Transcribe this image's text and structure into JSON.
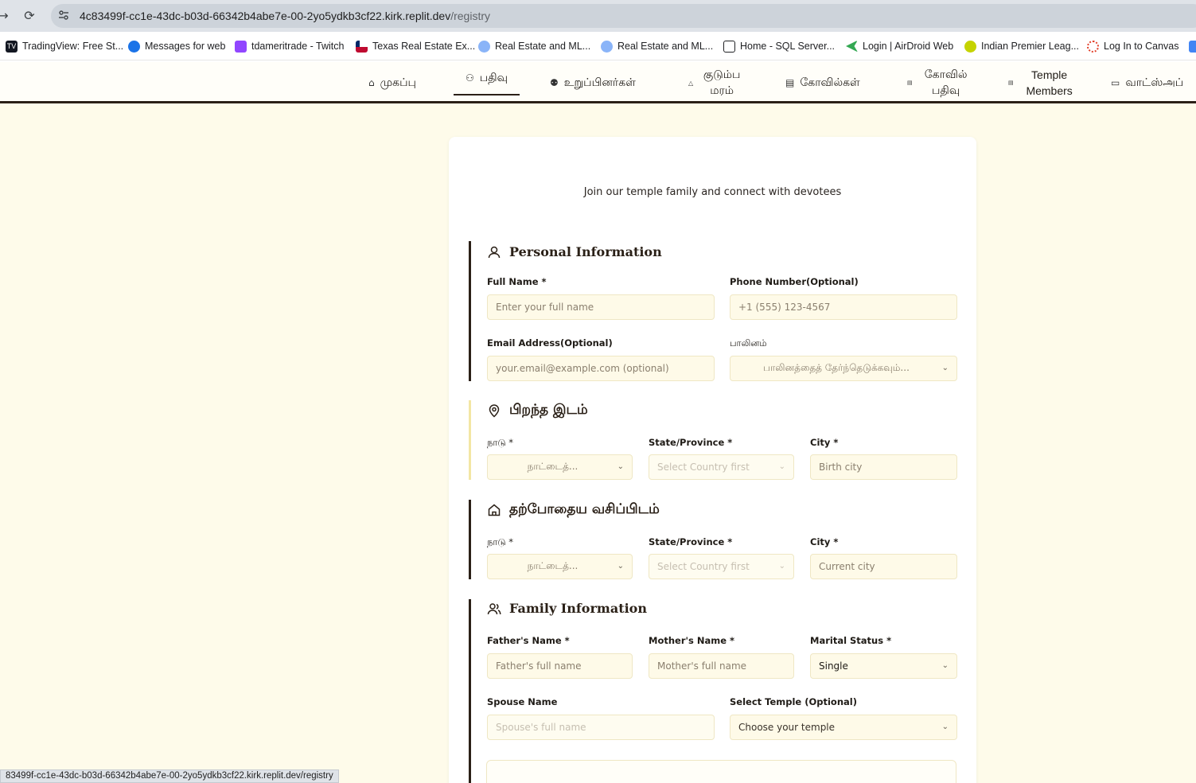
{
  "browser": {
    "url_host": "4c83499f-cc1e-43dc-b03d-66342b4abe7e-00-2yo5ydkb3cf22.kirk.replit.dev",
    "url_path": "/registry",
    "status_url": "83499f-cc1e-43dc-b03d-66342b4abe7e-00-2yo5ydkb3cf22.kirk.replit.dev/registry",
    "bookmarks": [
      {
        "label": "TradingView: Free St...",
        "icon": "tradingview-icon",
        "color": "#131722"
      },
      {
        "label": "Messages for web",
        "icon": "messages-icon",
        "color": "#1a73e8"
      },
      {
        "label": "tdameritrade - Twitch",
        "icon": "twitch-icon",
        "color": "#9146ff"
      },
      {
        "label": "Texas Real Estate Ex...",
        "icon": "texas-flag-icon",
        "color": "#bf0a30"
      },
      {
        "label": "Real Estate and ML...",
        "icon": "globe-icon",
        "color": "#8ab4f8"
      },
      {
        "label": "Real Estate and ML...",
        "icon": "globe-icon",
        "color": "#8ab4f8"
      },
      {
        "label": "Home - SQL Server...",
        "icon": "chart-icon",
        "color": "#202124"
      },
      {
        "label": "Login | AirDroid Web",
        "icon": "airdroid-icon",
        "color": "#34a853"
      },
      {
        "label": "Indian Premier Leag...",
        "icon": "ball-icon",
        "color": "#c5d300"
      },
      {
        "label": "Log In to Canvas",
        "icon": "canvas-icon",
        "color": "#e13f29"
      }
    ]
  },
  "nav": {
    "items": [
      {
        "label": "முகப்பு",
        "icon": "home-icon"
      },
      {
        "label": "பதிவு",
        "icon": "user-plus-icon",
        "active": true
      },
      {
        "label": "உறுப்பினர்கள்",
        "icon": "users-icon"
      },
      {
        "label": "குடும்ப மரம்",
        "icon": "tree-icon"
      },
      {
        "label": "கோவில்கள்",
        "icon": "building-icon"
      },
      {
        "label": "கோவில் பதிவு",
        "icon": "building-icon"
      },
      {
        "label": "Temple Members",
        "icon": "building-icon"
      },
      {
        "label": "வாட்ஸ்அப்",
        "icon": "message-icon"
      }
    ]
  },
  "form": {
    "subtitle": "Join our temple family and connect with devotees",
    "personal": {
      "title": "Personal Information",
      "full_name_label": "Full Name *",
      "full_name_placeholder": "Enter your full name",
      "phone_label": "Phone Number(Optional)",
      "phone_placeholder": "+1 (555) 123-4567",
      "email_label": "Email Address(Optional)",
      "email_placeholder": "your.email@example.com (optional)",
      "gender_label": "பாலினம்",
      "gender_placeholder": "பாலினத்தைத் தேர்ந்தெடுக்கவும்..."
    },
    "birth": {
      "title": "பிறந்த இடம்",
      "country_label": "நாடு *",
      "country_placeholder": "நாட்டைத்...",
      "state_label": "State/Province *",
      "state_placeholder": "Select Country first",
      "city_label": "City *",
      "city_placeholder": "Birth city"
    },
    "residence": {
      "title": "தற்போதைய வசிப்பிடம்",
      "country_label": "நாடு *",
      "country_placeholder": "நாட்டைத்...",
      "state_label": "State/Province *",
      "state_placeholder": "Select Country first",
      "city_label": "City *",
      "city_placeholder": "Current city"
    },
    "family": {
      "title": "Family Information",
      "father_label": "Father's Name *",
      "father_placeholder": "Father's full name",
      "mother_label": "Mother's Name *",
      "mother_placeholder": "Mother's full name",
      "marital_label": "Marital Status *",
      "marital_value": "Single",
      "spouse_label": "Spouse Name",
      "spouse_placeholder": "Spouse's full name",
      "temple_label": "Select Temple (Optional)",
      "temple_placeholder": "Choose your temple"
    }
  }
}
